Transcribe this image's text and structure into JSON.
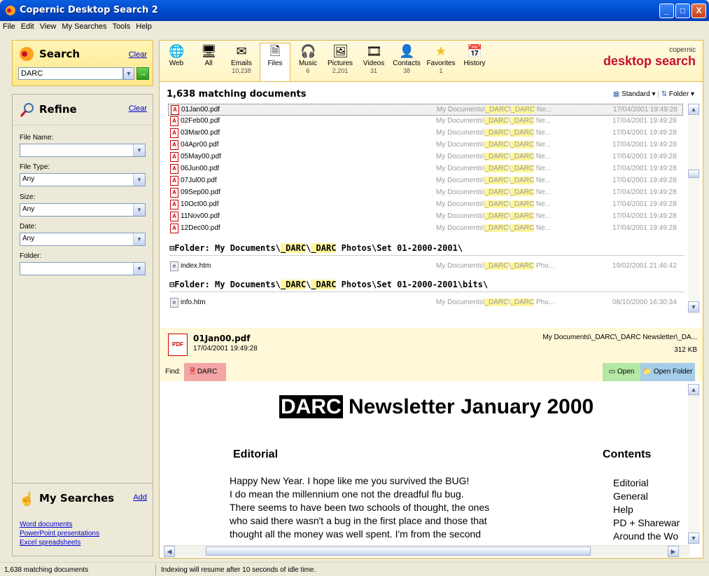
{
  "window": {
    "title": "Copernic Desktop Search 2",
    "min": "_",
    "max": "□",
    "close": "X"
  },
  "menu": [
    "File",
    "Edit",
    "View",
    "My Searches",
    "Tools",
    "Help"
  ],
  "search": {
    "heading": "Search",
    "clear": "Clear",
    "value": "DARC",
    "go": "→"
  },
  "refine": {
    "heading": "Refine",
    "clear": "Clear",
    "file_name": {
      "label": "File Name:",
      "value": ""
    },
    "file_type": {
      "label": "File Type:",
      "value": "Any"
    },
    "size": {
      "label": "Size:",
      "value": "Any"
    },
    "date": {
      "label": "Date:",
      "value": "Any"
    },
    "folder": {
      "label": "Folder:",
      "value": ""
    }
  },
  "my_searches": {
    "heading": "My Searches",
    "add": "Add",
    "items": [
      "Word documents",
      "PowerPoint presentations",
      "Excel spreadsheets"
    ]
  },
  "tabs": [
    {
      "label": "Web",
      "count": "",
      "icon": "web-icon"
    },
    {
      "label": "All",
      "count": "",
      "icon": "all-icon"
    },
    {
      "label": "Emails",
      "count": "10,238",
      "icon": "email-icon"
    },
    {
      "label": "Files",
      "count": "",
      "icon": "file-icon"
    },
    {
      "label": "Music",
      "count": "6",
      "icon": "music-icon"
    },
    {
      "label": "Pictures",
      "count": "2,201",
      "icon": "picture-icon"
    },
    {
      "label": "Videos",
      "count": "31",
      "icon": "video-icon"
    },
    {
      "label": "Contacts",
      "count": "38",
      "icon": "contact-icon"
    },
    {
      "label": "Favorites",
      "count": "1",
      "icon": "star-icon"
    },
    {
      "label": "History",
      "count": "",
      "icon": "calendar-icon"
    }
  ],
  "logo": {
    "top": "copernic",
    "main": "desktop search"
  },
  "results": {
    "heading": "1,638 matching documents",
    "view_label": "Standard ▾",
    "sort_label": "Folder ▾",
    "rows": [
      {
        "name": "01Jan00.pdf",
        "date": "17/04/2001 19:49:28"
      },
      {
        "name": "02Feb00.pdf",
        "date": "17/04/2001 19:49:28"
      },
      {
        "name": "03Mar00.pdf",
        "date": "17/04/2001 19:49:28"
      },
      {
        "name": "04Apr00.pdf",
        "date": "17/04/2001 19:49:28"
      },
      {
        "name": "05May00.pdf",
        "date": "17/04/2001 19:49:28"
      },
      {
        "name": "06Jun00.pdf",
        "date": "17/04/2001 19:49:28"
      },
      {
        "name": "07Jul00.pdf",
        "date": "17/04/2001 19:49:28"
      },
      {
        "name": "09Sep00.pdf",
        "date": "17/04/2001 19:49:28"
      },
      {
        "name": "10Oct00.pdf",
        "date": "17/04/2001 19:49:28"
      },
      {
        "name": "11Nov00.pdf",
        "date": "17/04/2001 19:49:28"
      },
      {
        "name": "12Dec00.pdf",
        "date": "17/04/2001 19:49:28"
      }
    ],
    "row_path_pre": "My Documents\\",
    "row_path_hl1": "_DARC",
    "row_path_mid": "\\",
    "row_path_hl2": "_DARC",
    "row_path_post": " Ne...",
    "folder1": {
      "prefix": "⊟Folder: My Documents\\",
      "hl1": "_DARC",
      "mid": "\\",
      "hl2": "_DARC",
      "suffix": " Photos\\Set 01-2000-2001\\"
    },
    "folder1_row": {
      "name": "index.htm",
      "path_pre": "My Documents\\",
      "hl1": "_DARC",
      "mid": "\\",
      "hl2": "_DARC",
      "post": " Pho...",
      "date": "19/02/2001 21:46:42"
    },
    "folder2": {
      "prefix": "⊟Folder: My Documents\\",
      "hl1": "_DARC",
      "mid": "\\",
      "hl2": "_DARC",
      "suffix": " Photos\\Set 01-2000-2001\\bits\\"
    },
    "folder2_row": {
      "name": "info.htm",
      "path_pre": "My Documents\\",
      "hl1": "_DARC",
      "mid": "\\",
      "hl2": "_DARC",
      "post": " Pho...",
      "date": "08/10/2000 16:30:34"
    }
  },
  "preview": {
    "file": "01Jan00.pdf",
    "date": "17/04/2001 19:49:28",
    "path": "My Documents\\_DARC\\_DARC Newsletter\\_DA...",
    "size": "312 KB",
    "find_label": "Find:",
    "find_term": "DARC",
    "open": "Open",
    "open_folder": "Open Folder",
    "doc_title_hl": "DARC",
    "doc_title_rest": " Newsletter January 2000",
    "editorial": "Editorial",
    "contents": "Contents",
    "body": [
      "Happy New Year. I hope like me you survived the BUG!",
      "I do mean the millennium one not the dreadful flu bug.",
      "There seems to have been two schools of thought, the ones",
      "who said there wasn't a bug in the first place and those that",
      "thought all the money was well spent. I'm from the second"
    ],
    "contents_items": [
      "Editorial",
      "General",
      "Help",
      "PD + Sharewar",
      "Around the Wo"
    ]
  },
  "status": {
    "left": "1,638 matching documents",
    "right": "Indexing will resume after 10 seconds of idle time."
  }
}
